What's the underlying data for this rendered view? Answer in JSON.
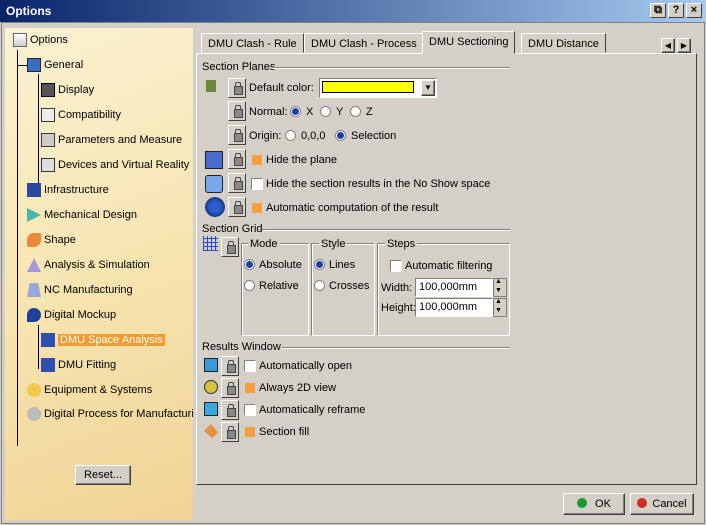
{
  "window": {
    "title": "Options"
  },
  "tree": [
    {
      "label": "Options"
    },
    {
      "label": "General"
    },
    {
      "label": "Display"
    },
    {
      "label": "Compatibility"
    },
    {
      "label": "Parameters and Measure"
    },
    {
      "label": "Devices and Virtual Reality"
    },
    {
      "label": "Infrastructure"
    },
    {
      "label": "Mechanical Design"
    },
    {
      "label": "Shape"
    },
    {
      "label": "Analysis & Simulation"
    },
    {
      "label": "NC Manufacturing"
    },
    {
      "label": "Digital Mockup"
    },
    {
      "label": "DMU Space Analysis"
    },
    {
      "label": "DMU Fitting"
    },
    {
      "label": "Equipment & Systems"
    },
    {
      "label": "Digital Process for Manufacturing"
    }
  ],
  "reset_label": "Reset...",
  "tabs": [
    "DMU Clash - Rule",
    "DMU Clash - Process",
    "DMU Sectioning",
    "DMU Distance"
  ],
  "section_planes": {
    "title": "Section Planes",
    "default_color_label": "Default color:",
    "default_color": "#ffff00",
    "normal_label": "Normal:",
    "normal_options": [
      "X",
      "Y",
      "Z"
    ],
    "normal_selected": "X",
    "origin_label": "Origin:",
    "origin_options": [
      "0,0,0",
      "Selection"
    ],
    "origin_selected": "Selection",
    "hide_plane": "Hide the plane",
    "hide_results": "Hide the section results in the No Show space",
    "auto_compute": "Automatic computation of the result"
  },
  "section_grid": {
    "title": "Section Grid",
    "mode_title": "Mode",
    "mode_options": [
      "Absolute",
      "Relative"
    ],
    "style_title": "Style",
    "style_options": [
      "Lines",
      "Crosses"
    ],
    "steps_title": "Steps",
    "auto_filter": "Automatic filtering",
    "width_label": "Width:",
    "width_value": "100,000mm",
    "height_label": "Height:",
    "height_value": "100,000mm"
  },
  "results_window": {
    "title": "Results Window",
    "auto_open": "Automatically open",
    "always_2d": "Always 2D view",
    "auto_reframe": "Automatically reframe",
    "section_fill": "Section fill"
  },
  "buttons": {
    "ok": "OK",
    "cancel": "Cancel"
  },
  "colors": {
    "title_start": "#0a246a",
    "accent_orange": "#f29a2e",
    "ok_green": "#1a9a2a",
    "cancel_red": "#d22b1f"
  }
}
